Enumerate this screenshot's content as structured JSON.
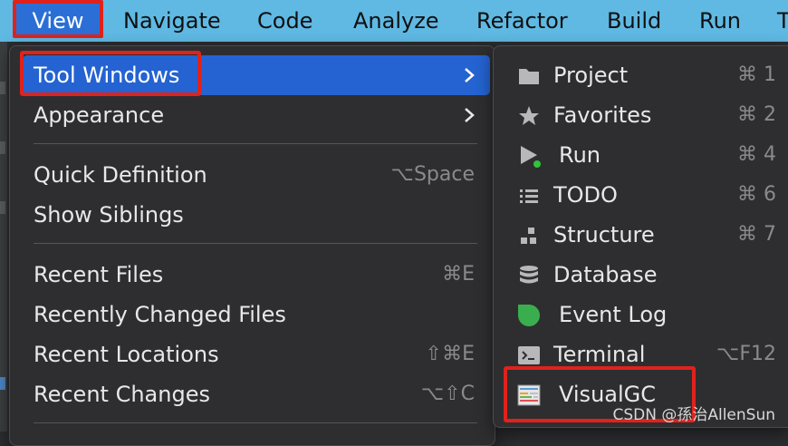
{
  "menubar": {
    "items": [
      "View",
      "Navigate",
      "Code",
      "Analyze",
      "Refactor",
      "Build",
      "Run",
      "T"
    ]
  },
  "view_menu": {
    "items": [
      {
        "label": "Tool Windows",
        "shortcut": "",
        "submenu": true,
        "selected": true
      },
      {
        "label": "Appearance",
        "shortcut": "",
        "submenu": true
      },
      {
        "label": "Quick Definition",
        "shortcut": "⌥Space"
      },
      {
        "label": "Show Siblings",
        "shortcut": ""
      },
      {
        "label": "Recent Files",
        "shortcut": "⌘E"
      },
      {
        "label": "Recently Changed Files",
        "shortcut": ""
      },
      {
        "label": "Recent Locations",
        "shortcut": "⇧⌘E"
      },
      {
        "label": "Recent Changes",
        "shortcut": "⌥⇧C"
      }
    ]
  },
  "tool_windows": {
    "items": [
      {
        "label": "Project",
        "shortcut": "⌘ 1",
        "icon": "folder-icon"
      },
      {
        "label": "Favorites",
        "shortcut": "⌘ 2",
        "icon": "star-icon"
      },
      {
        "label": "Run",
        "shortcut": "⌘ 4",
        "icon": "run-icon"
      },
      {
        "label": "TODO",
        "shortcut": "⌘ 6",
        "icon": "todo-list-icon"
      },
      {
        "label": "Structure",
        "shortcut": "⌘ 7",
        "icon": "structure-icon"
      },
      {
        "label": "Database",
        "shortcut": "",
        "icon": "database-icon"
      },
      {
        "label": "Event Log",
        "shortcut": "",
        "icon": "event-log-icon"
      },
      {
        "label": "Terminal",
        "shortcut": "⌥F12",
        "icon": "terminal-icon"
      },
      {
        "label": "VisualGC",
        "shortcut": "",
        "icon": "visualgc-icon"
      }
    ]
  },
  "colors": {
    "menubar_bg": "#5fb9e3",
    "selection": "#2463d1",
    "highlight_box": "#e0221c"
  },
  "watermark": "CSDN @孫治AllenSun"
}
